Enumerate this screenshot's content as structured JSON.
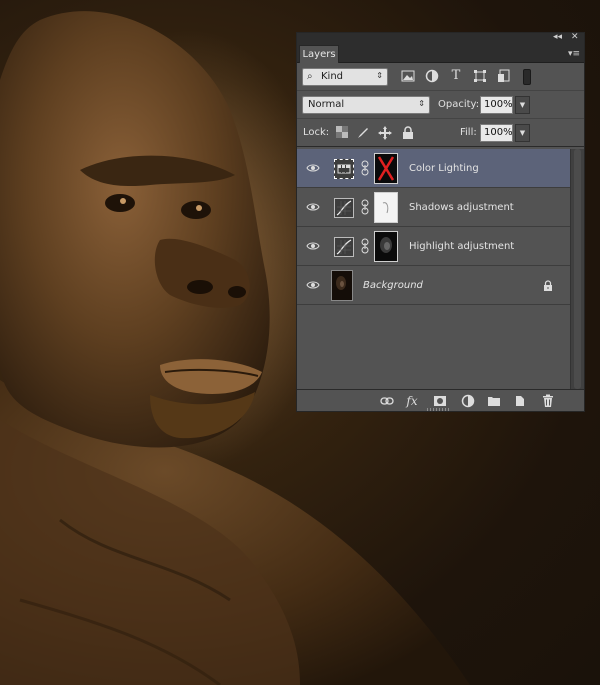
{
  "panel": {
    "tab_label": "Layers",
    "collapse_glyph": "◂◂",
    "close_glyph": "✕",
    "menu_glyph": "▾≡"
  },
  "filter": {
    "kind_label": "Kind",
    "icons": [
      "image-filter-icon",
      "adjustment-filter-icon",
      "type-filter-icon",
      "shape-filter-icon",
      "smart-object-filter-icon"
    ]
  },
  "blend": {
    "mode": "Normal",
    "opacity_label": "Opacity:",
    "opacity_value": "100%"
  },
  "lock": {
    "label": "Lock:",
    "fill_label": "Fill:",
    "fill_value": "100%"
  },
  "layers": [
    {
      "name": "Color Lighting",
      "selected": true,
      "type": "adjustment"
    },
    {
      "name": "Shadows adjustment",
      "selected": false,
      "type": "curves"
    },
    {
      "name": "Highlight adjustment",
      "selected": false,
      "type": "curves"
    },
    {
      "name": "Background",
      "selected": false,
      "type": "background",
      "locked": true
    }
  ],
  "bottom_icons": [
    "link-layers-icon",
    "fx-icon",
    "add-mask-icon",
    "new-adjustment-icon",
    "new-group-icon",
    "new-layer-icon",
    "delete-layer-icon"
  ],
  "colors": {
    "panel_bg": "#535353",
    "selected_row": "#5c6379",
    "photo_tone": "#8a5a2b"
  }
}
